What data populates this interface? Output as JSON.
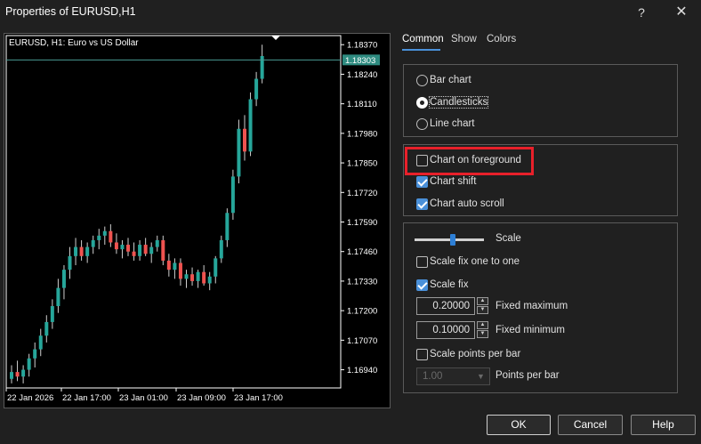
{
  "window": {
    "title": "Properties of EURUSD,H1",
    "help_glyph": "?",
    "close_glyph": "✕"
  },
  "tabs": [
    {
      "label": "Common",
      "active": true
    },
    {
      "label": "Show",
      "active": false
    },
    {
      "label": "Colors",
      "active": false
    }
  ],
  "chart_type_group": {
    "options": [
      {
        "label": "Bar chart",
        "selected": false
      },
      {
        "label": "Candlesticks",
        "selected": true
      },
      {
        "label": "Line chart",
        "selected": false
      }
    ]
  },
  "display_group": {
    "chart_on_foreground": {
      "label": "Chart on foreground",
      "checked": false
    },
    "chart_shift": {
      "label": "Chart shift",
      "checked": true
    },
    "chart_auto_scroll": {
      "label": "Chart auto scroll",
      "checked": true
    }
  },
  "scale_group": {
    "scale_label": "Scale",
    "scale_level": 0.55,
    "scale_fix_one_to_one": {
      "label": "Scale fix one to one",
      "checked": false
    },
    "scale_fix": {
      "label": "Scale fix",
      "checked": true
    },
    "fixed_maximum": {
      "value": "0.20000",
      "label": "Fixed maximum"
    },
    "fixed_minimum": {
      "value": "0.10000",
      "label": "Fixed minimum"
    },
    "scale_points_per_bar": {
      "label": "Scale points per bar",
      "checked": false
    },
    "points_per_bar": {
      "value": "1.00",
      "label": "Points per bar"
    }
  },
  "buttons": {
    "ok": "OK",
    "cancel": "Cancel",
    "help": "Help"
  },
  "colors": {
    "bull": "#26a69a",
    "bear": "#ef5350",
    "accent": "#4a90d9",
    "highlight": "#e8202a"
  },
  "chart_data": {
    "type": "candlestick",
    "title": "EURUSD, H1:  Euro vs US Dollar",
    "current_price": "1.18303",
    "ylim": [
      1.1686,
      1.1841
    ],
    "y_ticks": [
      "1.18370",
      "1.18240",
      "1.18110",
      "1.17980",
      "1.17850",
      "1.17720",
      "1.17590",
      "1.17460",
      "1.17330",
      "1.17200",
      "1.17070",
      "1.16940"
    ],
    "x_ticks": [
      "22 Jan 2026",
      "22 Jan 17:00",
      "23 Jan 01:00",
      "23 Jan 09:00",
      "23 Jan 17:00"
    ],
    "candles": [
      [
        1.169,
        1.1696,
        1.1688,
        1.1693
      ],
      [
        1.1693,
        1.1698,
        1.1689,
        1.1691
      ],
      [
        1.1691,
        1.1696,
        1.1688,
        1.1694
      ],
      [
        1.1694,
        1.1701,
        1.1691,
        1.1699
      ],
      [
        1.1699,
        1.1706,
        1.1695,
        1.1703
      ],
      [
        1.1703,
        1.1712,
        1.17,
        1.1709
      ],
      [
        1.1709,
        1.1718,
        1.1706,
        1.1715
      ],
      [
        1.1715,
        1.1725,
        1.1712,
        1.1722
      ],
      [
        1.1722,
        1.1734,
        1.1719,
        1.173
      ],
      [
        1.173,
        1.174,
        1.1725,
        1.1738
      ],
      [
        1.1738,
        1.1748,
        1.1734,
        1.1744
      ],
      [
        1.1744,
        1.1752,
        1.174,
        1.1748
      ],
      [
        1.1748,
        1.1751,
        1.1742,
        1.1744
      ],
      [
        1.1744,
        1.175,
        1.1741,
        1.1748
      ],
      [
        1.1748,
        1.1753,
        1.1745,
        1.1751
      ],
      [
        1.1751,
        1.1756,
        1.1747,
        1.1753
      ],
      [
        1.1753,
        1.1757,
        1.1749,
        1.1755
      ],
      [
        1.1755,
        1.1758,
        1.1748,
        1.175
      ],
      [
        1.175,
        1.1754,
        1.1745,
        1.1747
      ],
      [
        1.1747,
        1.1751,
        1.1743,
        1.1749
      ],
      [
        1.1749,
        1.1752,
        1.1744,
        1.1746
      ],
      [
        1.1746,
        1.175,
        1.1742,
        1.1744
      ],
      [
        1.1744,
        1.1751,
        1.1742,
        1.1749
      ],
      [
        1.1749,
        1.1752,
        1.1744,
        1.1745
      ],
      [
        1.1745,
        1.175,
        1.1741,
        1.1748
      ],
      [
        1.1748,
        1.1753,
        1.1746,
        1.1751
      ],
      [
        1.1751,
        1.1753,
        1.174,
        1.1742
      ],
      [
        1.1742,
        1.1745,
        1.1735,
        1.1738
      ],
      [
        1.1738,
        1.1743,
        1.1734,
        1.1741
      ],
      [
        1.1741,
        1.1743,
        1.1731,
        1.1734
      ],
      [
        1.1734,
        1.1738,
        1.173,
        1.1736
      ],
      [
        1.1736,
        1.1739,
        1.1731,
        1.1733
      ],
      [
        1.1733,
        1.1738,
        1.173,
        1.1737
      ],
      [
        1.1737,
        1.174,
        1.1731,
        1.1732
      ],
      [
        1.1732,
        1.1737,
        1.1729,
        1.1735
      ],
      [
        1.1735,
        1.1744,
        1.1732,
        1.1743
      ],
      [
        1.1743,
        1.1753,
        1.1741,
        1.1751
      ],
      [
        1.1751,
        1.1765,
        1.1748,
        1.1763
      ],
      [
        1.1763,
        1.1782,
        1.176,
        1.1779
      ],
      [
        1.1779,
        1.1804,
        1.1776,
        1.18
      ],
      [
        1.18,
        1.1806,
        1.1786,
        1.179
      ],
      [
        1.179,
        1.1816,
        1.1788,
        1.1813
      ],
      [
        1.1813,
        1.1825,
        1.181,
        1.1822
      ],
      [
        1.1822,
        1.1837,
        1.182,
        1.1832
      ]
    ]
  }
}
